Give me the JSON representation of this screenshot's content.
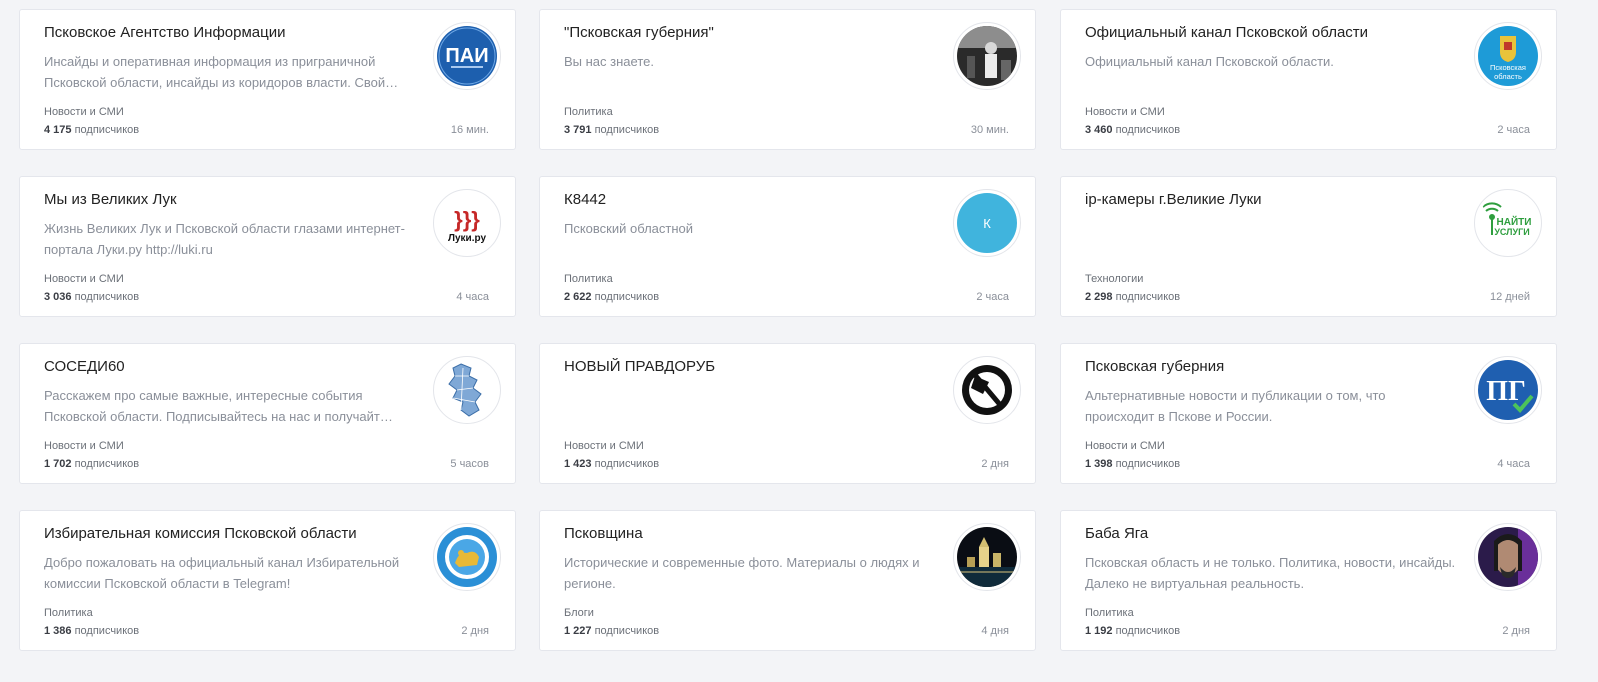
{
  "channels": [
    {
      "title": "Псковское Агентство Информации",
      "description": "Инсайды и оперативная информация из приграничной Псковской области, инсайды из коридоров власти. Свой…",
      "category": "Новости и СМИ",
      "subscribers": "4 175",
      "subscribers_label": "подписчиков",
      "time": "16 мин.",
      "avatar": "pai-logo-icon",
      "avatar_text": "ПАИ"
    },
    {
      "title": "\"Псковская губерния\"",
      "description": "Вы нас знаете.",
      "category": "Политика",
      "subscribers": "3 791",
      "subscribers_label": "подписчиков",
      "time": "30 мин.",
      "avatar": "bw-photo-avatar-icon"
    },
    {
      "title": "Официальный канал Псковской области",
      "description": "Официальный канал Псковской области.",
      "category": "Новости и СМИ",
      "subscribers": "3 460",
      "subscribers_label": "подписчиков",
      "time": "2 часа",
      "avatar": "pskov-region-emblem-icon",
      "avatar_text": "Псковская область"
    },
    {
      "title": "Мы из Великих Лук",
      "description": "Жизнь Великих Лук и Псковской области глазами интернет-портала Луки.ру http://luki.ru",
      "category": "Новости и СМИ",
      "subscribers": "3 036",
      "subscribers_label": "подписчиков",
      "time": "4 часа",
      "avatar": "luki-ru-logo-icon",
      "avatar_text": "Луки.ру"
    },
    {
      "title": "К8442",
      "description": "Псковский областной",
      "category": "Политика",
      "subscribers": "2 622",
      "subscribers_label": "подписчиков",
      "time": "2 часа",
      "avatar": "letter-k-avatar-icon",
      "avatar_text": "К"
    },
    {
      "title": "ip-камеры г.Великие Луки",
      "description": "",
      "category": "Технологии",
      "subscribers": "2 298",
      "subscribers_label": "подписчиков",
      "time": "12 дней",
      "avatar": "naiti-uslugi-logo-icon",
      "avatar_text": "НАЙТИ УСЛУГИ"
    },
    {
      "title": "СОСЕДИ60",
      "description": "Расскажем про самые важные, интересные события Псковской области. Подписывайтесь на нас и получайт…",
      "category": "Новости и СМИ",
      "subscribers": "1 702",
      "subscribers_label": "подписчиков",
      "time": "5 часов",
      "avatar": "region-map-icon"
    },
    {
      "title": "НОВЫЙ ПРАВДОРУБ",
      "description": "",
      "category": "Новости и СМИ",
      "subscribers": "1 423",
      "subscribers_label": "подписчиков",
      "time": "2 дня",
      "avatar": "axe-logo-icon"
    },
    {
      "title": "Псковская губерния",
      "description": "Альтернативные новости и публикации о том, что происходит в Пскове и России.",
      "category": "Новости и СМИ",
      "subscribers": "1 398",
      "subscribers_label": "подписчиков",
      "time": "4 часа",
      "avatar": "pg-logo-icon",
      "avatar_text": "ПГ"
    },
    {
      "title": "Избирательная комиссия Псковской области",
      "description": "Добро пожаловать на официальный канал Избирательной комиссии Псковской области в Telegram!",
      "category": "Политика",
      "subscribers": "1 386",
      "subscribers_label": "подписчиков",
      "time": "2 дня",
      "avatar": "election-commission-emblem-icon"
    },
    {
      "title": "Псковщина",
      "description": "Исторические и современные фото. Материалы о людях и регионе.",
      "category": "Блоги",
      "subscribers": "1 227",
      "subscribers_label": "подписчиков",
      "time": "4 дня",
      "avatar": "kremlin-night-photo-icon"
    },
    {
      "title": "Баба Яга",
      "description": "Псковская область и не только. Политика, новости, инсайды. Далеко не виртуальная реальность.",
      "category": "Политика",
      "subscribers": "1 192",
      "subscribers_label": "подписчиков",
      "time": "2 дня",
      "avatar": "portrait-photo-icon"
    }
  ],
  "colors": {
    "background": "#f3f4f7",
    "card": "#ffffff",
    "title": "#222222",
    "muted": "#8a8f99"
  }
}
